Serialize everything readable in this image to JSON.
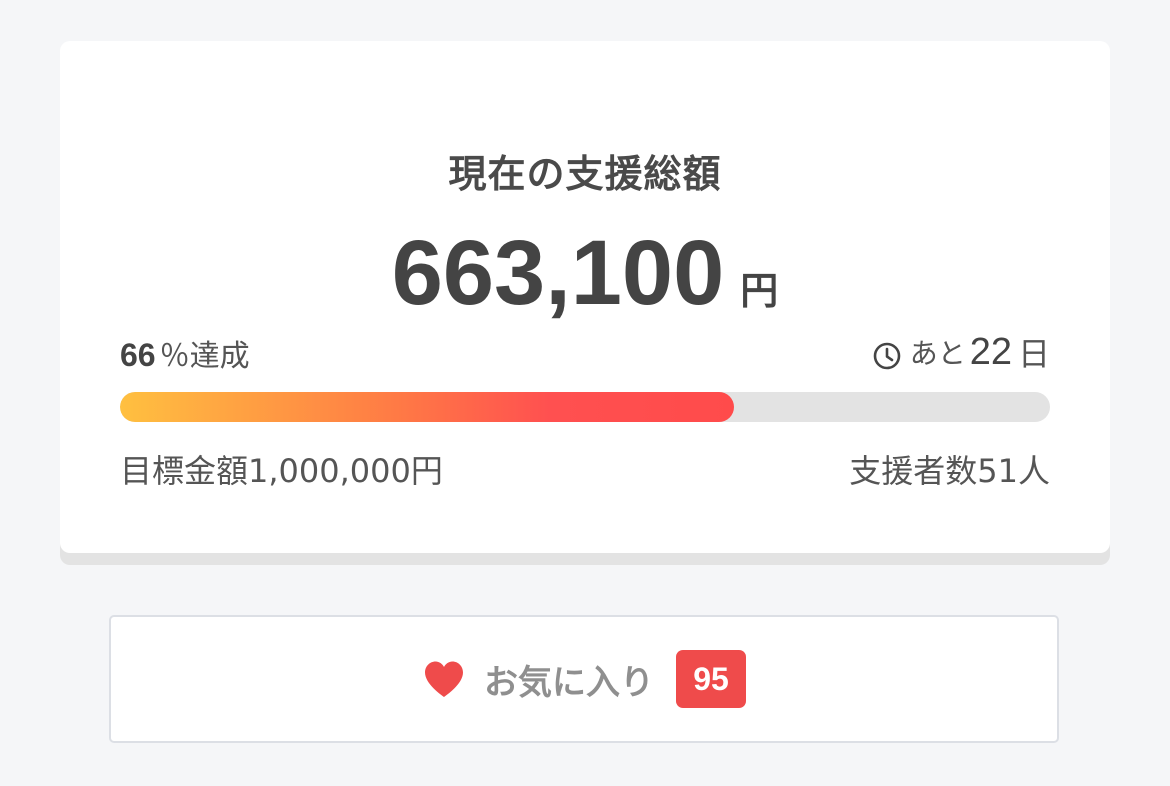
{
  "funding": {
    "title": "現在の支援総額",
    "amount": "663,100",
    "amount_unit": "円",
    "percent_value": "66",
    "percent_suffix": "％達成",
    "progress_percent": 66,
    "remaining_prefix": "あと",
    "remaining_days": "22",
    "remaining_suffix": "日",
    "goal_text": "目標金額1,000,000円",
    "supporters_text": "支援者数51人"
  },
  "favorite": {
    "label": "お気に入り",
    "count": "95"
  },
  "icons": {
    "clock": "clock-icon",
    "heart": "heart-icon"
  },
  "colors": {
    "progress_start": "#ffc040",
    "progress_end": "#ff4b4b",
    "heart": "#ef4b4b",
    "badge": "#ef4b4b"
  }
}
